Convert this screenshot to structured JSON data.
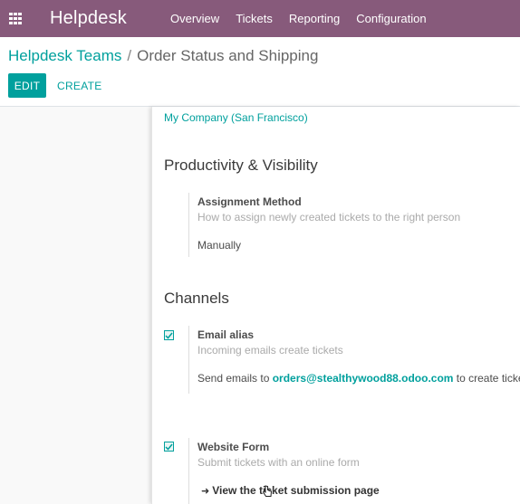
{
  "app": {
    "brand": "Helpdesk",
    "menu": [
      "Overview",
      "Tickets",
      "Reporting",
      "Configuration"
    ]
  },
  "breadcrumb": {
    "parent": "Helpdesk Teams",
    "separator": "/",
    "current": "Order Status and Shipping"
  },
  "buttons": {
    "edit": "EDIT",
    "create": "CREATE"
  },
  "company": "My Company (San Francisco)",
  "productivity": {
    "title": "Productivity & Visibility",
    "assignment_title": "Assignment Method",
    "assignment_desc": "How to assign newly created tickets to the right person",
    "assignment_value": "Manually"
  },
  "channels": {
    "title": "Channels",
    "email": {
      "checked": true,
      "title": "Email alias",
      "desc": "Incoming emails create tickets",
      "text_prefix": "Send emails to ",
      "address": "orders@stealthywood88.odoo.com",
      "text_suffix": " to create tickets"
    },
    "website": {
      "checked": true,
      "title": "Website Form",
      "desc": "Submit tickets with an online form",
      "link": "View the ticket submission page"
    }
  },
  "colors": {
    "topbar": "#875a7b",
    "accent": "#00a09d"
  }
}
